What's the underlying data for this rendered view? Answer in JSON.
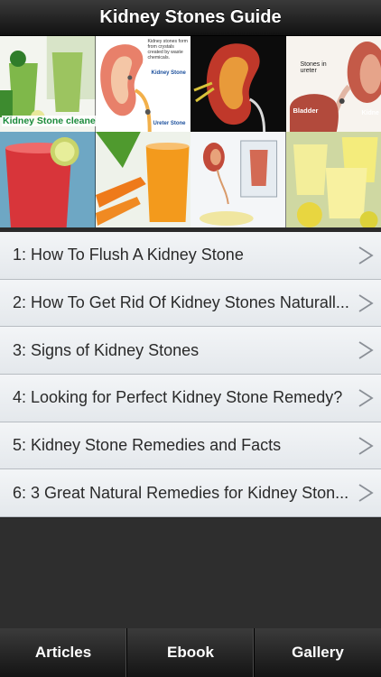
{
  "navbar": {
    "title": "Kidney Stones Guide"
  },
  "collage": {
    "tiles": [
      {
        "icon": "green-juice-image",
        "caption": "Kidney Stone cleaner"
      },
      {
        "icon": "kidney-diagram-image",
        "note": "Kidney stones form from crystals created by waste chemicals.",
        "label_a": "Kidney Stone",
        "label_b": "Ureter Stone"
      },
      {
        "icon": "kidney-anatomy-image"
      },
      {
        "icon": "kidney-ureter-diagram-image",
        "label_a": "Stones in ureter",
        "label_b": "Bladder",
        "label_c": "Kidne"
      },
      {
        "icon": "red-juice-image"
      },
      {
        "icon": "carrot-juice-image"
      },
      {
        "icon": "urinary-system-image"
      },
      {
        "icon": "lemonade-image"
      }
    ]
  },
  "articles": [
    {
      "label": "1: How To Flush A Kidney Stone"
    },
    {
      "label": "2: How To Get Rid Of Kidney Stones Naturall..."
    },
    {
      "label": "3: Signs of Kidney Stones"
    },
    {
      "label": "4: Looking for Perfect Kidney Stone Remedy?"
    },
    {
      "label": "5: Kidney Stone Remedies and Facts"
    },
    {
      "label": "6: 3 Great Natural Remedies for Kidney Ston..."
    }
  ],
  "tabbar": {
    "tabs": [
      {
        "label": "Articles"
      },
      {
        "label": "Ebook"
      },
      {
        "label": "Gallery"
      }
    ]
  },
  "colors": {
    "accent_green": "#1a8a3a",
    "list_text": "#2a2a2a",
    "chevron": "#8a8f96"
  }
}
